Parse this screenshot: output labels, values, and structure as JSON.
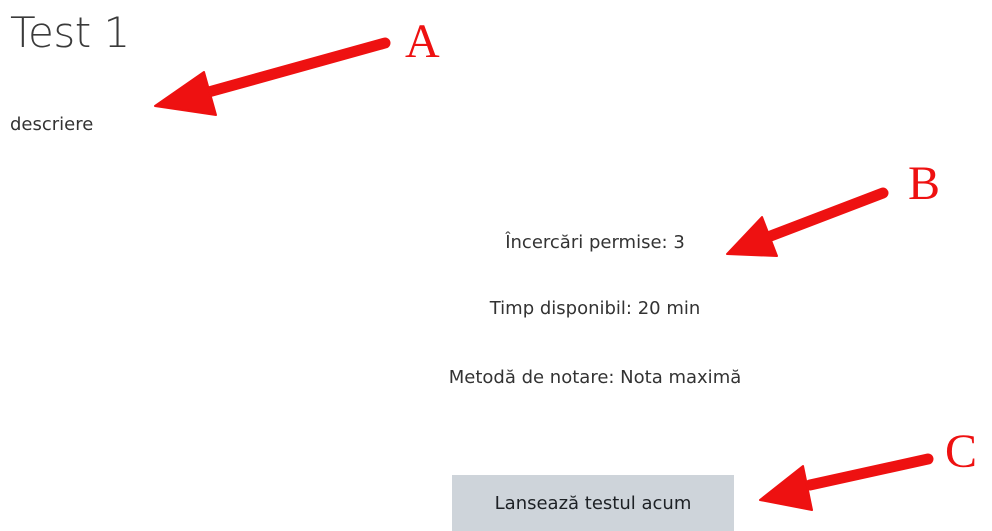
{
  "quiz": {
    "title": "Test 1",
    "description": "descriere",
    "attempts_allowed": "Încercări permise: 3",
    "time_limit": "Timp disponibil: 20 min",
    "grading_method": "Metodă de notare: Nota maximă",
    "start_button_label": "Lansează testul acum"
  },
  "annotations": {
    "label_a": "A",
    "label_b": "B",
    "label_c": "C",
    "color": "#ee1111"
  },
  "colors": {
    "button_bg": "#ced4da",
    "text": "#333333"
  }
}
